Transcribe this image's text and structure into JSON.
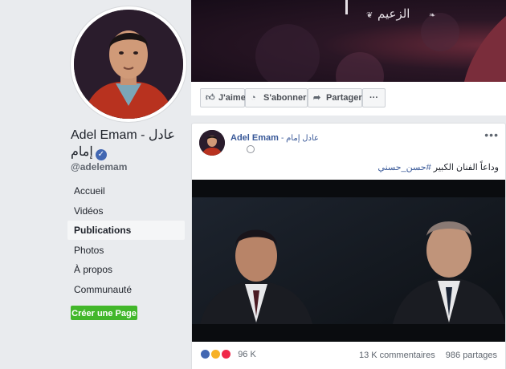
{
  "profile": {
    "name_line1": "Adel Emam - عادل",
    "name_line2": "إمام",
    "username": "@adelemam"
  },
  "nav": {
    "items": [
      {
        "label": "Accueil"
      },
      {
        "label": "Vidéos"
      },
      {
        "label": "Publications",
        "active": true
      },
      {
        "label": "Photos"
      },
      {
        "label": "À propos"
      },
      {
        "label": "Communauté"
      }
    ]
  },
  "create_page_label": "Créer une Page",
  "cover": {
    "title": "الزعيم"
  },
  "actions": {
    "like": "J'aime",
    "follow": "S'abonner",
    "share": "Partager",
    "more": "···"
  },
  "post": {
    "author": "Adel Emam",
    "author_ar": "- عادل إمام",
    "text": "وداعاً الفنان الكبير ",
    "hashtag": "#حسن_حسني",
    "reactions_count": "96 K",
    "comments": "13 K commentaires",
    "shares": "986 partages"
  },
  "colors": {
    "link": "#385898",
    "green_button": "#42b72a",
    "verified": "#4267b2"
  }
}
